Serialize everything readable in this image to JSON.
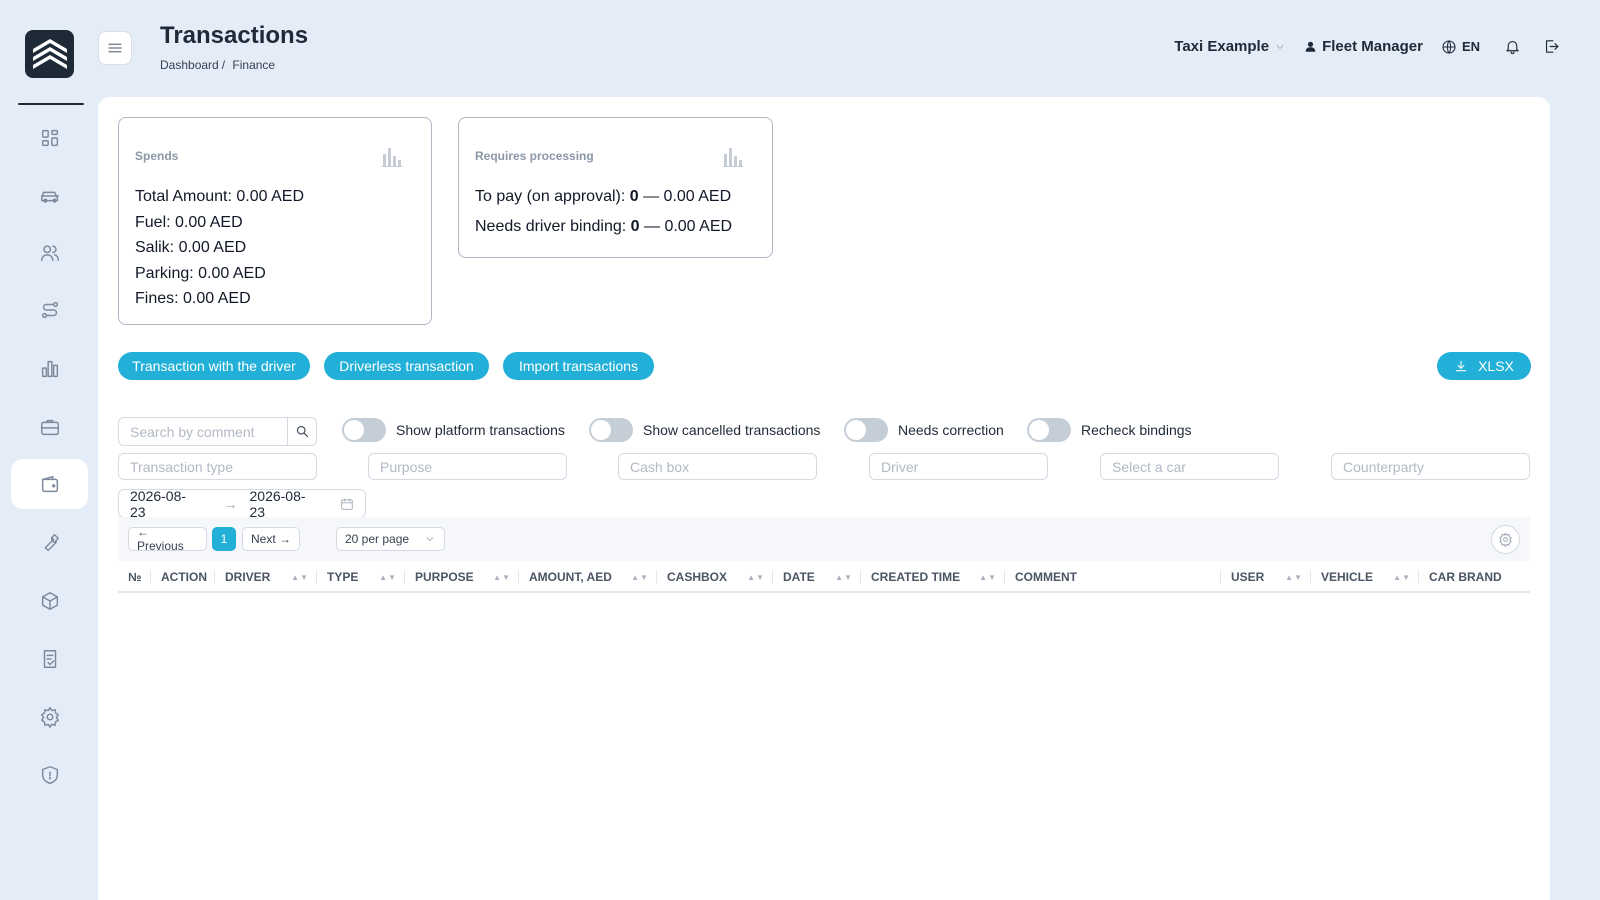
{
  "header": {
    "title": "Transactions",
    "breadcrumb": [
      "Dashboard",
      "Finance"
    ],
    "company": "Taxi Example",
    "user": "Fleet Manager",
    "language": "EN"
  },
  "sidebar": {
    "items": [
      {
        "name": "dashboard",
        "icon": "grid-icon"
      },
      {
        "name": "vehicles",
        "icon": "car-icon"
      },
      {
        "name": "drivers",
        "icon": "users-icon"
      },
      {
        "name": "routes",
        "icon": "route-icon"
      },
      {
        "name": "reports",
        "icon": "bar-chart-icon"
      },
      {
        "name": "business",
        "icon": "briefcase-icon"
      },
      {
        "name": "finance",
        "icon": "wallet-icon",
        "active": true
      },
      {
        "name": "service",
        "icon": "wrench-icon"
      },
      {
        "name": "inventory",
        "icon": "box-icon"
      },
      {
        "name": "documents",
        "icon": "checklist-icon"
      },
      {
        "name": "settings",
        "icon": "gear-icon"
      },
      {
        "name": "security",
        "icon": "shield-icon"
      }
    ]
  },
  "cards": {
    "spends": {
      "title": "Spends",
      "lines": [
        "Total Amount: 0.00 AED",
        "Fuel: 0.00 AED",
        "Salik: 0.00 AED",
        "Parking: 0.00 AED",
        "Fines: 0.00 AED"
      ]
    },
    "processing": {
      "title": "Requires processing",
      "to_pay_label": "To pay (on approval): ",
      "to_pay_count": "0",
      "to_pay_amount": " — 0.00 AED",
      "binding_label": "Needs driver binding: ",
      "binding_count": "0",
      "binding_amount": " — 0.00 AED"
    }
  },
  "actions": {
    "with_driver": "Transaction with the driver",
    "driverless": "Driverless transaction",
    "import": "Import transactions",
    "export": "XLSX"
  },
  "filters": {
    "search_placeholder": "Search by comment",
    "toggles": [
      "Show platform transactions",
      "Show cancelled transactions",
      "Needs correction",
      "Recheck bindings"
    ],
    "transaction_type": "Transaction type",
    "purpose": "Purpose",
    "cash_box": "Cash box",
    "driver": "Driver",
    "car": "Select a car",
    "counterparty": "Counterparty",
    "date_from": "2026-08-23",
    "date_to": "2026-08-23",
    "date_arrow": "→"
  },
  "pagination": {
    "previous": "← Previous",
    "current": "1",
    "next": "Next →",
    "per_page": "20 per page"
  },
  "table": {
    "columns": [
      "№",
      "ACTION",
      "DRIVER",
      "TYPE",
      "PURPOSE",
      "AMOUNT, AED",
      "CASHBOX",
      "DATE",
      "CREATED TIME",
      "COMMENT",
      "USER",
      "VEHICLE",
      "CAR BRAND"
    ],
    "sort_glyph": "▲▼"
  }
}
